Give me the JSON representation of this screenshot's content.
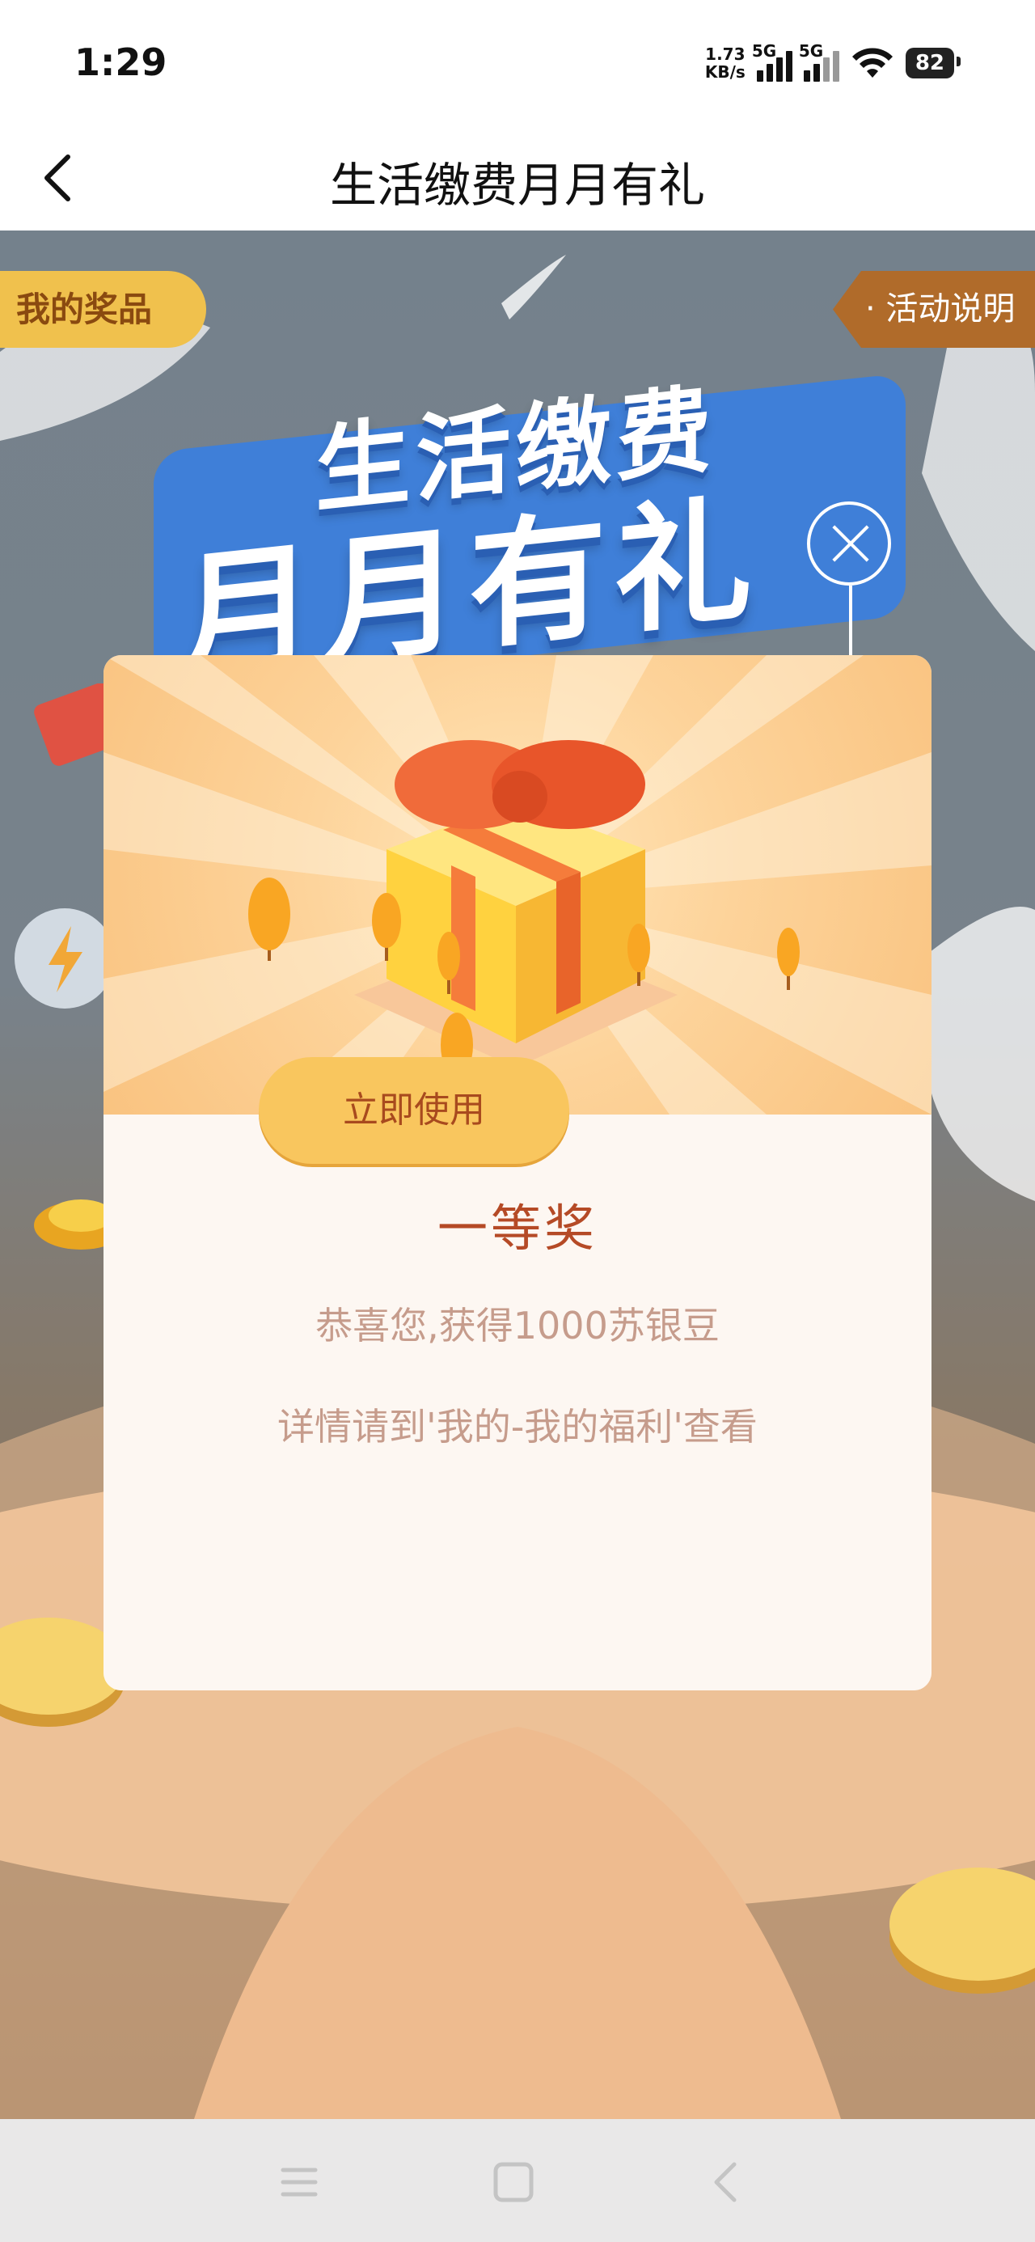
{
  "status_bar": {
    "time": "1:29",
    "net_speed_value": "1.73",
    "net_speed_unit": "KB/s",
    "sim1_label": "5G",
    "sim2_label": "5G",
    "battery": "82"
  },
  "nav": {
    "title": "生活缴费月月有礼"
  },
  "page": {
    "my_prizes_label": "我的奖品",
    "rules_label": "· 活动说明",
    "banner_line1": "生活缴费",
    "banner_line2": "月月有礼"
  },
  "modal": {
    "prize_level": "一等奖",
    "prize_desc": "恭喜您,获得1000苏银豆",
    "prize_detail": "详情请到'我的-我的福利'查看",
    "use_button": "立即使用"
  },
  "colors": {
    "modal_header": "#fdd39a",
    "button": "#f9c65e",
    "prize_text": "#b54a26",
    "body_text": "#c69c8c"
  }
}
